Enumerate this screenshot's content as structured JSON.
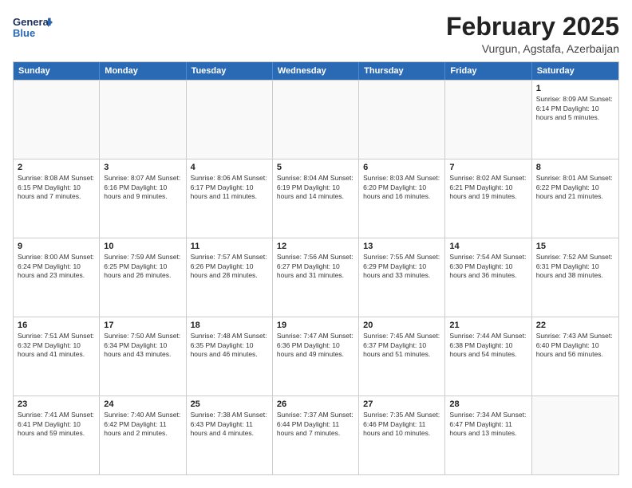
{
  "header": {
    "logo_general": "General",
    "logo_blue": "Blue",
    "month_title": "February 2025",
    "location": "Vurgun, Agstafa, Azerbaijan"
  },
  "calendar": {
    "days_of_week": [
      "Sunday",
      "Monday",
      "Tuesday",
      "Wednesday",
      "Thursday",
      "Friday",
      "Saturday"
    ],
    "weeks": [
      [
        {
          "day": "",
          "info": ""
        },
        {
          "day": "",
          "info": ""
        },
        {
          "day": "",
          "info": ""
        },
        {
          "day": "",
          "info": ""
        },
        {
          "day": "",
          "info": ""
        },
        {
          "day": "",
          "info": ""
        },
        {
          "day": "1",
          "info": "Sunrise: 8:09 AM\nSunset: 6:14 PM\nDaylight: 10 hours and 5 minutes."
        }
      ],
      [
        {
          "day": "2",
          "info": "Sunrise: 8:08 AM\nSunset: 6:15 PM\nDaylight: 10 hours and 7 minutes."
        },
        {
          "day": "3",
          "info": "Sunrise: 8:07 AM\nSunset: 6:16 PM\nDaylight: 10 hours and 9 minutes."
        },
        {
          "day": "4",
          "info": "Sunrise: 8:06 AM\nSunset: 6:17 PM\nDaylight: 10 hours and 11 minutes."
        },
        {
          "day": "5",
          "info": "Sunrise: 8:04 AM\nSunset: 6:19 PM\nDaylight: 10 hours and 14 minutes."
        },
        {
          "day": "6",
          "info": "Sunrise: 8:03 AM\nSunset: 6:20 PM\nDaylight: 10 hours and 16 minutes."
        },
        {
          "day": "7",
          "info": "Sunrise: 8:02 AM\nSunset: 6:21 PM\nDaylight: 10 hours and 19 minutes."
        },
        {
          "day": "8",
          "info": "Sunrise: 8:01 AM\nSunset: 6:22 PM\nDaylight: 10 hours and 21 minutes."
        }
      ],
      [
        {
          "day": "9",
          "info": "Sunrise: 8:00 AM\nSunset: 6:24 PM\nDaylight: 10 hours and 23 minutes."
        },
        {
          "day": "10",
          "info": "Sunrise: 7:59 AM\nSunset: 6:25 PM\nDaylight: 10 hours and 26 minutes."
        },
        {
          "day": "11",
          "info": "Sunrise: 7:57 AM\nSunset: 6:26 PM\nDaylight: 10 hours and 28 minutes."
        },
        {
          "day": "12",
          "info": "Sunrise: 7:56 AM\nSunset: 6:27 PM\nDaylight: 10 hours and 31 minutes."
        },
        {
          "day": "13",
          "info": "Sunrise: 7:55 AM\nSunset: 6:29 PM\nDaylight: 10 hours and 33 minutes."
        },
        {
          "day": "14",
          "info": "Sunrise: 7:54 AM\nSunset: 6:30 PM\nDaylight: 10 hours and 36 minutes."
        },
        {
          "day": "15",
          "info": "Sunrise: 7:52 AM\nSunset: 6:31 PM\nDaylight: 10 hours and 38 minutes."
        }
      ],
      [
        {
          "day": "16",
          "info": "Sunrise: 7:51 AM\nSunset: 6:32 PM\nDaylight: 10 hours and 41 minutes."
        },
        {
          "day": "17",
          "info": "Sunrise: 7:50 AM\nSunset: 6:34 PM\nDaylight: 10 hours and 43 minutes."
        },
        {
          "day": "18",
          "info": "Sunrise: 7:48 AM\nSunset: 6:35 PM\nDaylight: 10 hours and 46 minutes."
        },
        {
          "day": "19",
          "info": "Sunrise: 7:47 AM\nSunset: 6:36 PM\nDaylight: 10 hours and 49 minutes."
        },
        {
          "day": "20",
          "info": "Sunrise: 7:45 AM\nSunset: 6:37 PM\nDaylight: 10 hours and 51 minutes."
        },
        {
          "day": "21",
          "info": "Sunrise: 7:44 AM\nSunset: 6:38 PM\nDaylight: 10 hours and 54 minutes."
        },
        {
          "day": "22",
          "info": "Sunrise: 7:43 AM\nSunset: 6:40 PM\nDaylight: 10 hours and 56 minutes."
        }
      ],
      [
        {
          "day": "23",
          "info": "Sunrise: 7:41 AM\nSunset: 6:41 PM\nDaylight: 10 hours and 59 minutes."
        },
        {
          "day": "24",
          "info": "Sunrise: 7:40 AM\nSunset: 6:42 PM\nDaylight: 11 hours and 2 minutes."
        },
        {
          "day": "25",
          "info": "Sunrise: 7:38 AM\nSunset: 6:43 PM\nDaylight: 11 hours and 4 minutes."
        },
        {
          "day": "26",
          "info": "Sunrise: 7:37 AM\nSunset: 6:44 PM\nDaylight: 11 hours and 7 minutes."
        },
        {
          "day": "27",
          "info": "Sunrise: 7:35 AM\nSunset: 6:46 PM\nDaylight: 11 hours and 10 minutes."
        },
        {
          "day": "28",
          "info": "Sunrise: 7:34 AM\nSunset: 6:47 PM\nDaylight: 11 hours and 13 minutes."
        },
        {
          "day": "",
          "info": ""
        }
      ]
    ]
  }
}
